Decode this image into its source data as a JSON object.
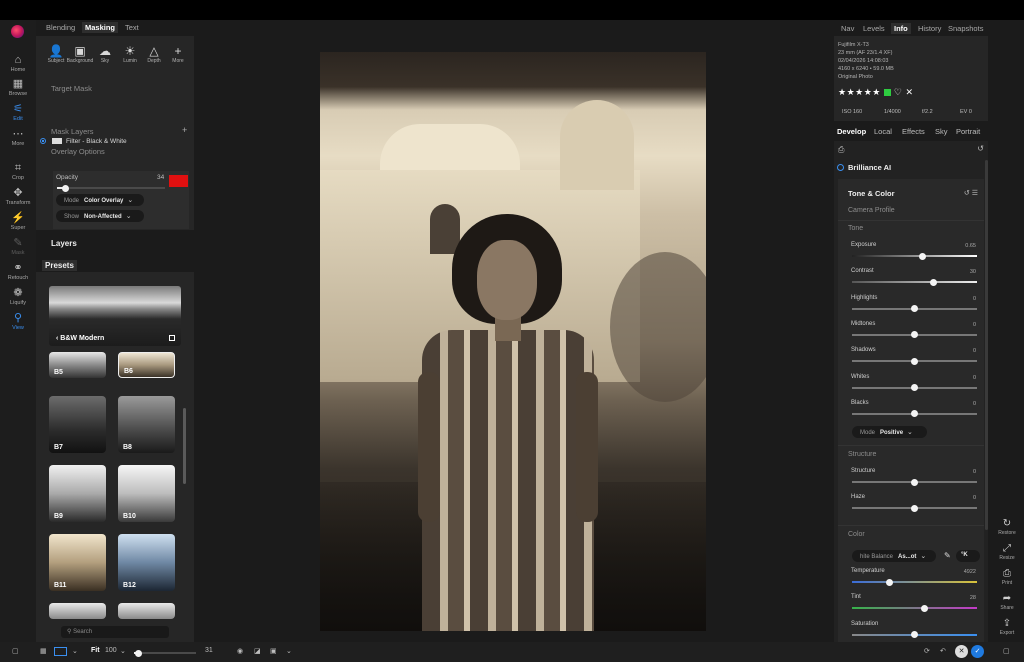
{
  "left_rail": {
    "items": [
      {
        "label": "Home",
        "icon": "home-icon",
        "glyph": "⌂"
      },
      {
        "label": "Browse",
        "icon": "grid-icon",
        "glyph": "▦"
      },
      {
        "label": "Edit",
        "icon": "sliders-icon",
        "glyph": "⚟"
      },
      {
        "label": "More",
        "icon": "more-icon",
        "glyph": "⋯"
      },
      {
        "label": "Crop",
        "icon": "crop-icon",
        "glyph": "⌗"
      },
      {
        "label": "Transform",
        "icon": "transform-icon",
        "glyph": "✥"
      },
      {
        "label": "Super",
        "icon": "wand-icon",
        "glyph": "⚡"
      },
      {
        "label": "Mask",
        "icon": "mask-icon",
        "glyph": "✎"
      },
      {
        "label": "Retouch",
        "icon": "retouch-icon",
        "glyph": "⚭"
      },
      {
        "label": "Liquify",
        "icon": "liquify-icon",
        "glyph": "❁"
      },
      {
        "label": "View",
        "icon": "view-icon",
        "glyph": "⚲"
      }
    ]
  },
  "left_panel": {
    "tabs": [
      "Blending",
      "Masking",
      "Text"
    ],
    "selected_tab": "Masking",
    "mask_tools": [
      {
        "label": "Subject",
        "glyph": "👤"
      },
      {
        "label": "Background",
        "glyph": "▣"
      },
      {
        "label": "Sky",
        "glyph": "☁"
      },
      {
        "label": "Lumin",
        "glyph": "☀"
      },
      {
        "label": "Depth",
        "glyph": "△"
      },
      {
        "label": "More",
        "glyph": "+"
      }
    ],
    "target_mask_label": "Target Mask",
    "target_mask_item": "Filter - Black & White",
    "mask_layers_label": "Mask Layers",
    "overlay_options_label": "Overlay Options",
    "opacity_label": "Opacity",
    "opacity_value": "34",
    "opacity_fraction": 0.08,
    "overlay_color": "#e01010",
    "mode_label": "Mode",
    "mode_value": "Color Overlay",
    "show_label": "Show",
    "show_value": "Non-Affected",
    "layers_label": "Layers",
    "presets_label": "Presets",
    "preset_group": "B&W Modern",
    "presets": [
      "B5",
      "B6",
      "B7",
      "B8",
      "B9",
      "B10",
      "B11",
      "B12"
    ],
    "search_placeholder": "Search"
  },
  "right_panel": {
    "tabs": [
      "Nav",
      "Levels",
      "Info",
      "History",
      "Snapshots"
    ],
    "selected_tab": "Info",
    "info": {
      "camera": "Fujifilm X-T3",
      "lens": "23 mm (AF 23/1.4 XF)",
      "date": "02/04/2026 14:08:03",
      "dimensions": "4160 x 6240 • 59.0 MB",
      "type": "Original Photo",
      "rating": "★★★★★",
      "iso": "ISO 160",
      "shutter": "1/4000",
      "aperture": "f/2.2",
      "ev": "EV 0"
    },
    "dev_tabs": [
      "Develop",
      "Local",
      "Effects",
      "Sky",
      "Portrait"
    ],
    "selected_dev_tab": "Develop",
    "brilliance_ai": "Brilliance AI",
    "tone_color": "Tone & Color",
    "camera_profile": "Camera Profile",
    "tone_label": "Tone",
    "structure_label": "Structure",
    "color_label": "Color",
    "tone_sliders": [
      {
        "label": "Exposure",
        "value": "0.65",
        "pos": 0.56
      },
      {
        "label": "Contrast",
        "value": "30",
        "pos": 0.65
      },
      {
        "label": "Highlights",
        "value": "0",
        "pos": 0.5
      },
      {
        "label": "Midtones",
        "value": "0",
        "pos": 0.5
      },
      {
        "label": "Shadows",
        "value": "0",
        "pos": 0.5
      },
      {
        "label": "Whites",
        "value": "0",
        "pos": 0.5
      },
      {
        "label": "Blacks",
        "value": "0",
        "pos": 0.5
      }
    ],
    "mode_label": "Mode",
    "mode_value": "Positive",
    "structure_sliders": [
      {
        "label": "Structure",
        "value": "0",
        "pos": 0.5
      },
      {
        "label": "Haze",
        "value": "0",
        "pos": 0.5
      }
    ],
    "white_balance_label": "hite Balance",
    "white_balance_value": "As...ot",
    "kelvin_label": "°K",
    "color_sliders": [
      {
        "label": "Temperature",
        "value": "4922",
        "pos": 0.3
      },
      {
        "label": "Tint",
        "value": "28",
        "pos": 0.58
      },
      {
        "label": "Saturation",
        "value": "",
        "pos": 0.5
      }
    ],
    "side_actions": [
      "Restore",
      "Resize",
      "Print",
      "Share",
      "Export"
    ]
  },
  "bottom_bar": {
    "fit_label": "Fit",
    "zoom_value": "100",
    "thumb_size": "31"
  }
}
